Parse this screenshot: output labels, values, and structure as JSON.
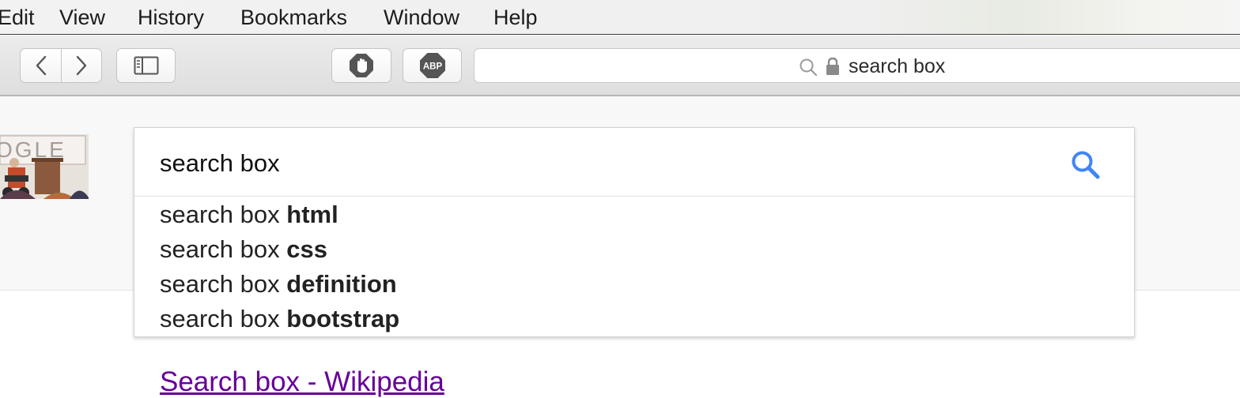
{
  "menubar": {
    "items": [
      "Edit",
      "View",
      "History",
      "Bookmarks",
      "Window",
      "Help"
    ]
  },
  "toolbar": {
    "back_icon": "chevron-left-icon",
    "forward_icon": "chevron-right-icon",
    "sidebar_icon": "sidebar-icon",
    "extension1_icon": "hand-stop-icon",
    "extension2_label": "ABP",
    "address": {
      "text": "search box",
      "search_icon": "magnifier-icon",
      "lock_icon": "lock-icon"
    }
  },
  "search": {
    "query": "search box",
    "button_icon": "search-icon",
    "suggestions": [
      {
        "prefix": "search box ",
        "completion": "html"
      },
      {
        "prefix": "search box ",
        "completion": "css"
      },
      {
        "prefix": "search box ",
        "completion": "definition"
      },
      {
        "prefix": "search box ",
        "completion": "bootstrap"
      }
    ]
  },
  "results": {
    "first_title": "Search box - Wikipedia"
  },
  "colors": {
    "result_link": "#660099",
    "search_icon": "#4285f4"
  }
}
